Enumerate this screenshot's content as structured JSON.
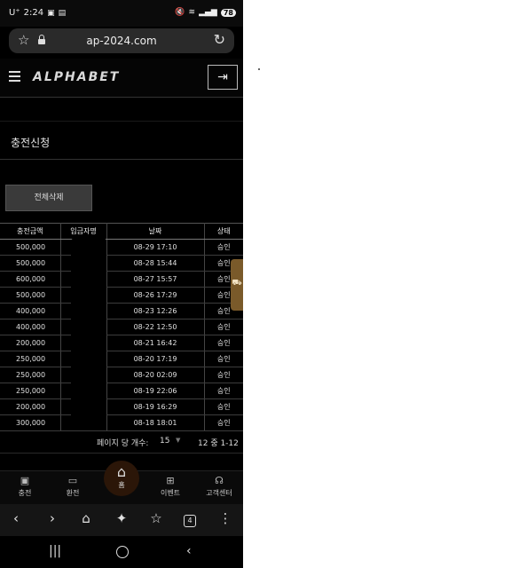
{
  "status_bar": {
    "carrier": "U⁺",
    "time": "2:24",
    "battery": "78"
  },
  "browser": {
    "url": "ap-2024.com",
    "tabs_count": "4"
  },
  "site": {
    "logo": "ALPHABET",
    "page_title": "충전신청",
    "delete_all_label": "전체삭제"
  },
  "table": {
    "headers": [
      "충전금액",
      "입금자명",
      "날짜",
      "상태"
    ],
    "rows": [
      {
        "amount": "500,000",
        "date": "08-29 17:10",
        "status": "승인"
      },
      {
        "amount": "500,000",
        "date": "08-28 15:44",
        "status": "승인"
      },
      {
        "amount": "600,000",
        "date": "08-27 15:57",
        "status": "승인"
      },
      {
        "amount": "500,000",
        "date": "08-26 17:29",
        "status": "승인"
      },
      {
        "amount": "400,000",
        "date": "08-23 12:26",
        "status": "승인"
      },
      {
        "amount": "400,000",
        "date": "08-22 12:50",
        "status": "승인"
      },
      {
        "amount": "200,000",
        "date": "08-21 16:42",
        "status": "승인"
      },
      {
        "amount": "250,000",
        "date": "08-20 17:19",
        "status": "승인"
      },
      {
        "amount": "250,000",
        "date": "08-20 02:09",
        "status": "승인"
      },
      {
        "amount": "250,000",
        "date": "08-19 22:06",
        "status": "승인"
      },
      {
        "amount": "200,000",
        "date": "08-19 16:29",
        "status": "승인"
      },
      {
        "amount": "300,000",
        "date": "08-18 18:01",
        "status": "승인"
      }
    ]
  },
  "pagination": {
    "per_page_label": "페이지 당 개수:",
    "per_page_value": "15",
    "range_info": "12 중 1-12"
  },
  "bottom_nav": {
    "charge": "충전",
    "exchange": "환전",
    "home": "홈",
    "event": "이벤트",
    "support": "고객센터"
  },
  "colors": {
    "background": "#000000",
    "accent_brown": "#7a5a2a",
    "home_circle": "#2b1608"
  }
}
